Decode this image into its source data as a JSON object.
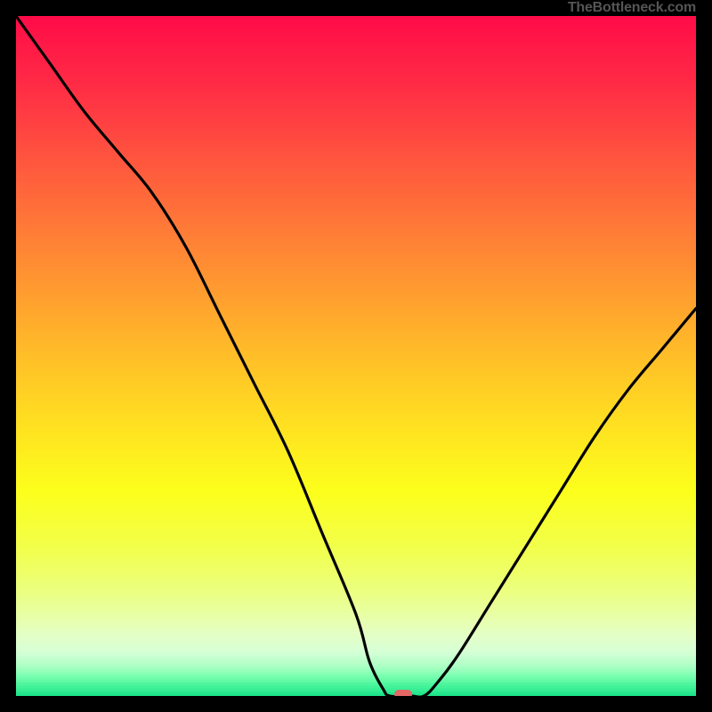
{
  "attribution": "TheBottleneck.com",
  "chart_data": {
    "type": "line",
    "title": "",
    "xlabel": "",
    "ylabel": "",
    "xlim": [
      0,
      100
    ],
    "ylim": [
      0,
      100
    ],
    "grid": false,
    "legend": false,
    "annotations": [],
    "series": [
      {
        "name": "bottleneck-curve",
        "x": [
          0,
          5,
          10,
          15,
          20,
          25,
          30,
          35,
          40,
          45,
          50,
          52,
          54,
          55,
          58,
          60,
          62,
          65,
          70,
          75,
          80,
          85,
          90,
          95,
          100
        ],
        "values": [
          100,
          93,
          86,
          80,
          74,
          66,
          56,
          46,
          36,
          24,
          12,
          5,
          1,
          0,
          0,
          0,
          2,
          6,
          14,
          22,
          30,
          38,
          45,
          51,
          57
        ]
      }
    ],
    "marker": {
      "x": 57,
      "y": 0,
      "color": "#e36767",
      "w_frac": 0.026,
      "h_frac": 0.013
    },
    "background_gradient": [
      {
        "stop": 0.0,
        "color": "#ff0c48"
      },
      {
        "stop": 0.1,
        "color": "#ff2b45"
      },
      {
        "stop": 0.2,
        "color": "#ff513f"
      },
      {
        "stop": 0.3,
        "color": "#ff7638"
      },
      {
        "stop": 0.4,
        "color": "#ff9a30"
      },
      {
        "stop": 0.5,
        "color": "#ffbe28"
      },
      {
        "stop": 0.6,
        "color": "#ffe021"
      },
      {
        "stop": 0.7,
        "color": "#fcff1c"
      },
      {
        "stop": 0.78,
        "color": "#f2ff4a"
      },
      {
        "stop": 0.84,
        "color": "#ecff7a"
      },
      {
        "stop": 0.88,
        "color": "#e8ffa4"
      },
      {
        "stop": 0.91,
        "color": "#e4ffc6"
      },
      {
        "stop": 0.935,
        "color": "#d6ffd6"
      },
      {
        "stop": 0.955,
        "color": "#b0ffc6"
      },
      {
        "stop": 0.97,
        "color": "#7cffb0"
      },
      {
        "stop": 0.985,
        "color": "#47f49b"
      },
      {
        "stop": 1.0,
        "color": "#19e188"
      }
    ]
  }
}
